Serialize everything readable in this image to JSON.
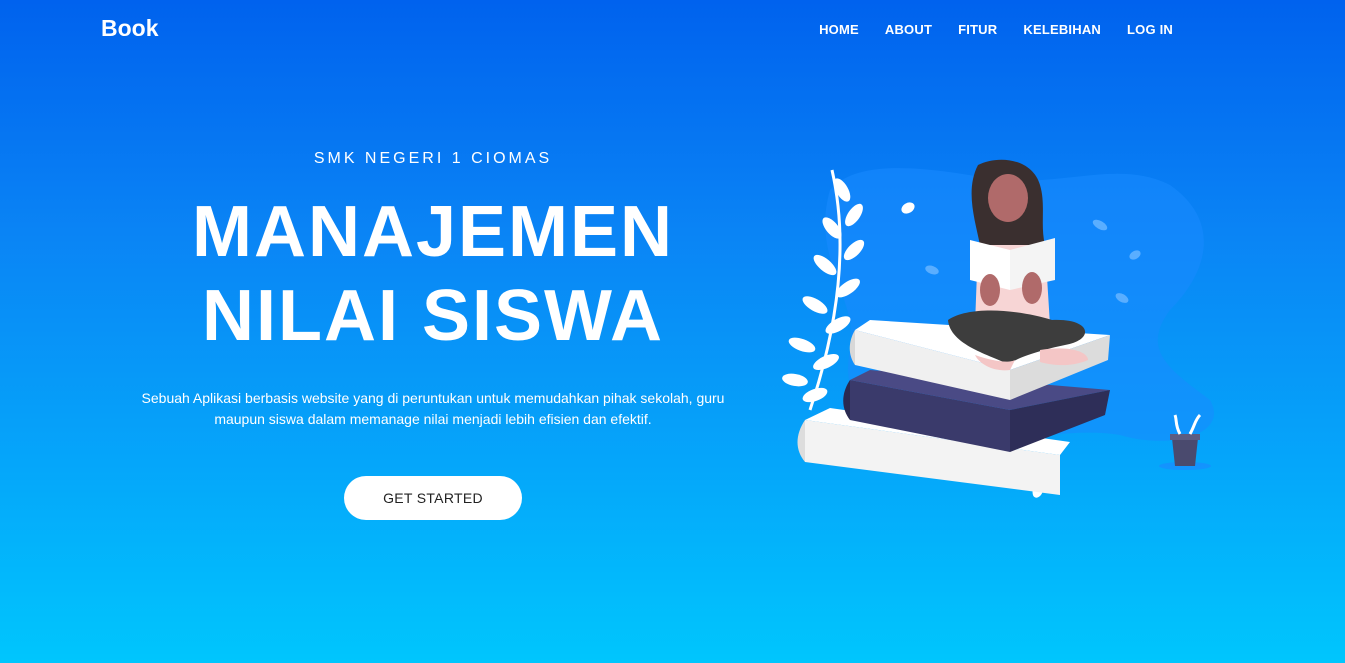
{
  "navbar": {
    "brand": "Book",
    "links": [
      "HOME",
      "ABOUT",
      "FITUR",
      "KELEBIHAN",
      "LOG IN"
    ]
  },
  "hero": {
    "eyebrow": "SMK NEGERI 1 CIOMAS",
    "title_line1": "MANAJEMEN",
    "title_line2": "NILAI SISWA",
    "description_line1": "Sebuah Aplikasi berbasis website yang di peruntukan untuk memudahkan pihak sekolah, guru",
    "description_line2": "maupun siswa dalam memanage nilai menjadi lebih efisien dan efektif.",
    "cta_label": "GET STARTED"
  },
  "colors": {
    "gradient_top": "#0062ee",
    "gradient_bottom": "#00c6fd",
    "book_dark": "#3a3a6b",
    "book_light": "#eeeeee"
  }
}
